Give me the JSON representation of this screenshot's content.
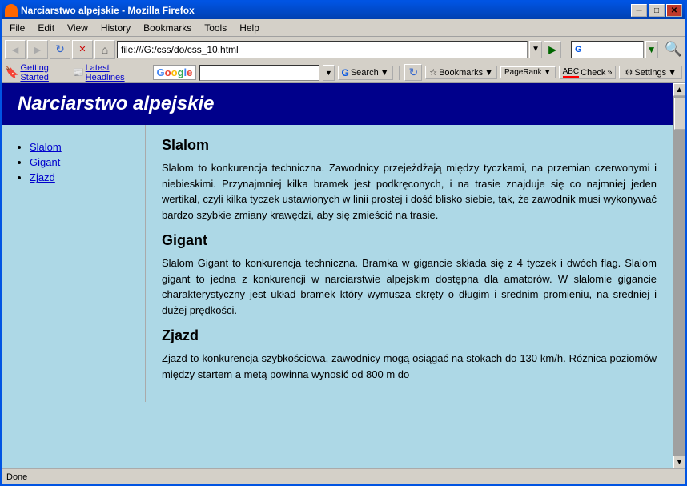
{
  "window": {
    "title": "Narciarstwo alpejskie - Mozilla Firefox",
    "titleIcon": "firefox-icon"
  },
  "titleControls": {
    "minimize": "─",
    "maximize": "□",
    "close": "✕"
  },
  "menuBar": {
    "items": [
      "File",
      "Edit",
      "View",
      "History",
      "Bookmarks",
      "Tools",
      "Help"
    ]
  },
  "navBar": {
    "back": "◄",
    "forward": "►",
    "refresh": "↻",
    "stop": "✕",
    "home": "⌂",
    "address": "file:///G:/css/do/css_10.html",
    "go": "▶"
  },
  "bookmarksBar": {
    "gettingStarted": "Getting Started",
    "latestHeadlines": "Latest Headlines",
    "googleLogo": "Google",
    "searchPlaceholder": "",
    "searchLabel": "Search",
    "bookmarks": "Bookmarks",
    "pageRank": "PageRank",
    "check": "Check",
    "settings": "Settings"
  },
  "page": {
    "title": "Narciarstwo alpejskie",
    "nav": {
      "items": [
        "Slalom",
        "Gigant",
        "Zjazd"
      ]
    },
    "sections": [
      {
        "id": "slalom",
        "heading": "Slalom",
        "text": "Slalom to konkurencja techniczna. Zawodnicy przejeżdżają między tyczkami, na przemian czerwonymi i niebieskimi. Przynajmniej kilka bramek jest podkręconych, i na trasie znajduje się co najmniej jeden wertikal, czyli kilka tyczek ustawionych w linii prostej i dość blisko siebie, tak, że zawodnik musi wykonywać bardzo szybkie zmiany krawędzi, aby się zmieścić na trasie."
      },
      {
        "id": "gigant",
        "heading": "Gigant",
        "text": "Slalom Gigant to konkurencja techniczna. Bramka w gigancie składa się z 4 tyczek i dwóch flag. Slalom gigant to jedna z konkurencji w narciarstwie alpejskim dostępna dla amatorów. W slalomie gigancie charakterystyczny jest układ bramek który wymusza skręty o długim i srednim promieniu, na sredniej i dużej prędkości."
      },
      {
        "id": "zjazd",
        "heading": "Zjazd",
        "text": "Zjazd to konkurencja szybkościowa, zawodnicy mogą osiągać na stokach do 130 km/h. Różnica poziomów między startem a metą powinna wynosić od 800 m do"
      }
    ]
  },
  "statusBar": {
    "text": "Done"
  }
}
